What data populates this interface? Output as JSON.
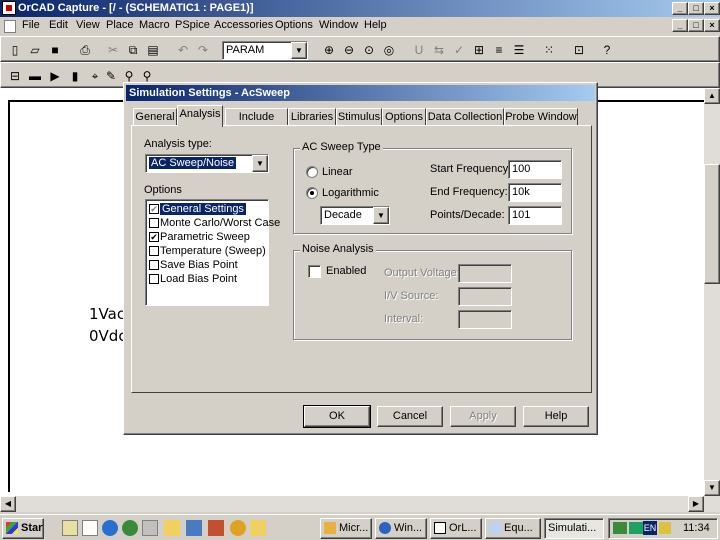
{
  "app": {
    "title": "OrCAD Capture - [/ - (SCHEMATIC1 : PAGE1)]",
    "caption_buttons": [
      "_",
      "□",
      "×"
    ],
    "doc_buttons": [
      "_",
      "□",
      "×"
    ]
  },
  "menu": [
    "File",
    "Edit",
    "View",
    "Place",
    "Macro",
    "PSpice",
    "Accessories",
    "Options",
    "Window",
    "Help"
  ],
  "toolbar": {
    "part_combo_value": "PARAM"
  },
  "schematic": {
    "text_1": "1Vac",
    "text_2": "0Vdc"
  },
  "dialog": {
    "title": "Simulation Settings - AcSweep",
    "tabs": [
      "General",
      "Analysis",
      "Include Files",
      "Libraries",
      "Stimulus",
      "Options",
      "Data Collection",
      "Probe Window"
    ],
    "active_tab": "Analysis",
    "analysis_type_label": "Analysis type:",
    "analysis_type_value": "AC Sweep/Noise",
    "options_label": "Options",
    "options": [
      {
        "label": "General Settings",
        "checked": true,
        "selected": true
      },
      {
        "label": "Monte Carlo/Worst Case",
        "checked": false,
        "selected": false
      },
      {
        "label": "Parametric Sweep",
        "checked": true,
        "selected": false
      },
      {
        "label": "Temperature (Sweep)",
        "checked": false,
        "selected": false
      },
      {
        "label": "Save Bias Point",
        "checked": false,
        "selected": false
      },
      {
        "label": "Load Bias Point",
        "checked": false,
        "selected": false
      }
    ],
    "ac_sweep": {
      "group_title": "AC Sweep Type",
      "linear_label": "Linear",
      "log_label": "Logarithmic",
      "log_selected": true,
      "log_type_value": "Decade",
      "start_label": "Start Frequency:",
      "start_value": "100",
      "end_label": "End Frequency:",
      "end_value": "10k",
      "points_label": "Points/Decade:",
      "points_value": "101"
    },
    "noise": {
      "group_title": "Noise Analysis",
      "enabled_label": "Enabled",
      "enabled": false,
      "output_voltage_label": "Output Voltage:",
      "iv_source_label": "I/V Source:",
      "interval_label": "Interval:"
    },
    "buttons": {
      "ok": "OK",
      "cancel": "Cancel",
      "apply": "Apply",
      "help": "Help"
    }
  },
  "taskbar": {
    "start_label": "Start",
    "tasks": [
      "Micr...",
      "Win...",
      "OrL...",
      "Equ...",
      "Simulati..."
    ],
    "active_task": "Simulati...",
    "clock": "11:34",
    "lang": "EN"
  },
  "colors": {
    "title_active": "#0a246a",
    "face": "#d4d0c8",
    "selection": "#0a246a"
  }
}
